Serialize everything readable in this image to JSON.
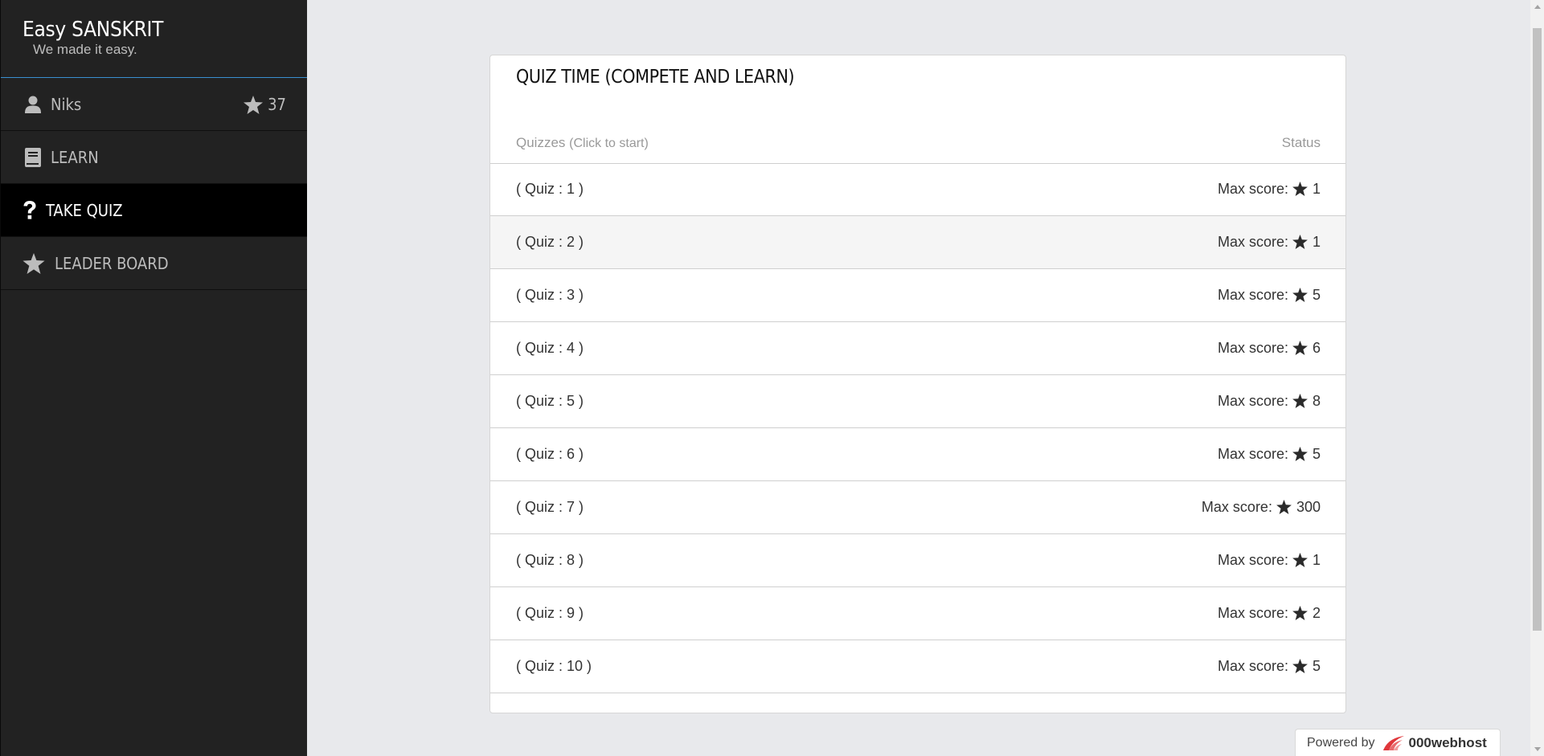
{
  "brand": {
    "title": "Easy SANSKRIT",
    "tagline": "We made it easy."
  },
  "user": {
    "name": "Niks",
    "score": "37"
  },
  "nav": [
    {
      "label": "LEARN",
      "icon": "book-icon",
      "active": false
    },
    {
      "label": "TAKE QUIZ",
      "icon": "question-icon",
      "active": true
    },
    {
      "label": "LEADER BOARD",
      "icon": "star-icon",
      "active": false
    }
  ],
  "panel": {
    "title": "QUIZ TIME (COMPETE AND LEARN)",
    "col_quizzes": "Quizzes",
    "col_quizzes_hint": "(Click to start)",
    "col_status": "Status"
  },
  "quizzes": [
    {
      "name": "( Quiz : 1 )",
      "status_label": "Max score:",
      "score": "1"
    },
    {
      "name": "( Quiz : 2 )",
      "status_label": "Max score:",
      "score": "1"
    },
    {
      "name": "( Quiz : 3 )",
      "status_label": "Max score:",
      "score": "5"
    },
    {
      "name": "( Quiz : 4 )",
      "status_label": "Max score:",
      "score": "6"
    },
    {
      "name": "( Quiz : 5 )",
      "status_label": "Max score:",
      "score": "8"
    },
    {
      "name": "( Quiz : 6 )",
      "status_label": "Max score:",
      "score": "5"
    },
    {
      "name": "( Quiz : 7 )",
      "status_label": "Max score:",
      "score": "300"
    },
    {
      "name": "( Quiz : 8 )",
      "status_label": "Max score:",
      "score": "1"
    },
    {
      "name": "( Quiz : 9 )",
      "status_label": "Max score:",
      "score": "2"
    },
    {
      "name": "( Quiz : 10 )",
      "status_label": "Max score:",
      "score": "5"
    }
  ],
  "footer": {
    "powered_by": "Powered by",
    "host": "000webhost"
  },
  "colors": {
    "sidebar": "#222222",
    "active_nav": "#000000",
    "accent_line": "#3a8fd0",
    "background": "#e8e9ec",
    "logo_red": "#e0373b"
  }
}
